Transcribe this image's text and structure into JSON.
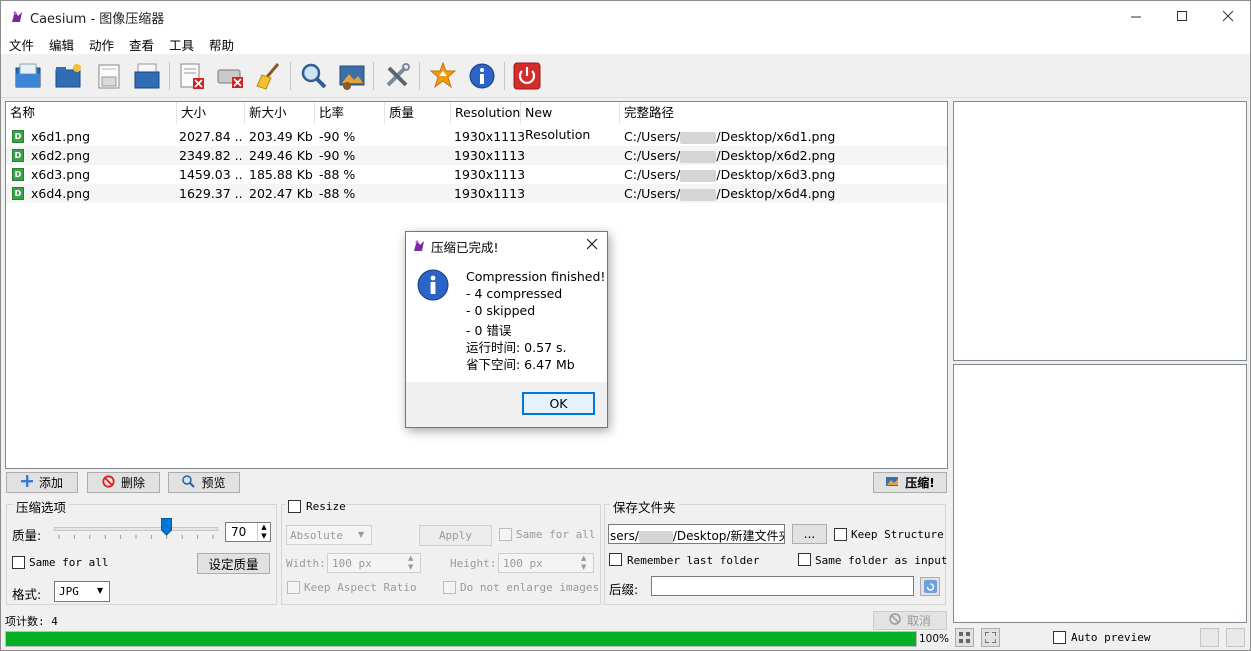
{
  "window": {
    "title": "Caesium - 图像压缩器"
  },
  "menu": [
    "文件",
    "编辑",
    "动作",
    "查看",
    "工具",
    "帮助"
  ],
  "columns": [
    "名称",
    "大小",
    "新大小",
    "比率",
    "质量",
    "Resolution",
    "New Resolution",
    "完整路径"
  ],
  "files": [
    {
      "name": "x6d1.png",
      "size": "2027.84 ...",
      "new_size": "203.49 Kb",
      "ratio": "-90 %",
      "quality": "",
      "resolution": "1930x1113",
      "new_resolution": "",
      "path_prefix": "C:/Users/",
      "path_suffix": "/Desktop/x6d1.png"
    },
    {
      "name": "x6d2.png",
      "size": "2349.82 ...",
      "new_size": "249.46 Kb",
      "ratio": "-90 %",
      "quality": "",
      "resolution": "1930x1113",
      "new_resolution": "",
      "path_prefix": "C:/Users/",
      "path_suffix": "/Desktop/x6d2.png"
    },
    {
      "name": "x6d3.png",
      "size": "1459.03 ...",
      "new_size": "185.88 Kb",
      "ratio": "-88 %",
      "quality": "",
      "resolution": "1930x1113",
      "new_resolution": "",
      "path_prefix": "C:/Users/",
      "path_suffix": "/Desktop/x6d3.png"
    },
    {
      "name": "x6d4.png",
      "size": "1629.37 ...",
      "new_size": "202.47 Kb",
      "ratio": "-88 %",
      "quality": "",
      "resolution": "1930x1113",
      "new_resolution": "",
      "path_prefix": "C:/Users/",
      "path_suffix": "/Desktop/x6d4.png"
    }
  ],
  "actions": {
    "add": "添加",
    "delete": "删除",
    "preview": "预览",
    "compress": "压缩!"
  },
  "compression": {
    "group_title": "压缩选项",
    "quality_label": "质量:",
    "quality_value": "70",
    "quality_fraction": 0.7,
    "same_for_all": "Same for all",
    "set_quality": "设定质量",
    "format_label": "格式:",
    "format_value": "JPG"
  },
  "resize": {
    "title": "Resize",
    "mode": "Absolute",
    "apply": "Apply",
    "same_for_all": "Same for all",
    "width_label": "Width:",
    "width_value": "100 px",
    "height_label": "Height:",
    "height_value": "100 px",
    "keep_ratio": "Keep Aspect Ratio",
    "no_enlarge": "Do not enlarge images"
  },
  "output": {
    "group_title": "保存文件夹",
    "folder_value": "sers/",
    "folder_suffix": "/Desktop/新建文件夹",
    "browse": "...",
    "keep_structure": "Keep Structure",
    "remember_last": "Remember last folder",
    "same_folder": "Same folder as input",
    "suffix_label": "后缀:",
    "suffix_value": ""
  },
  "status": {
    "item_count": "项计数: 4",
    "cancel": "取消",
    "progress_text": "100%",
    "progress_fraction": 1.0,
    "auto_preview": "Auto preview"
  },
  "dialog": {
    "title": "压缩已完成!",
    "lines": [
      "Compression finished!",
      "- 4 compressed",
      "- 0 skipped",
      "- 0 错误",
      "运行时间: 0.57 s.",
      "省下空间: 6.47 Mb"
    ],
    "ok": "OK"
  },
  "colors": {
    "progress": "#06b025",
    "accent": "#0078d7"
  }
}
